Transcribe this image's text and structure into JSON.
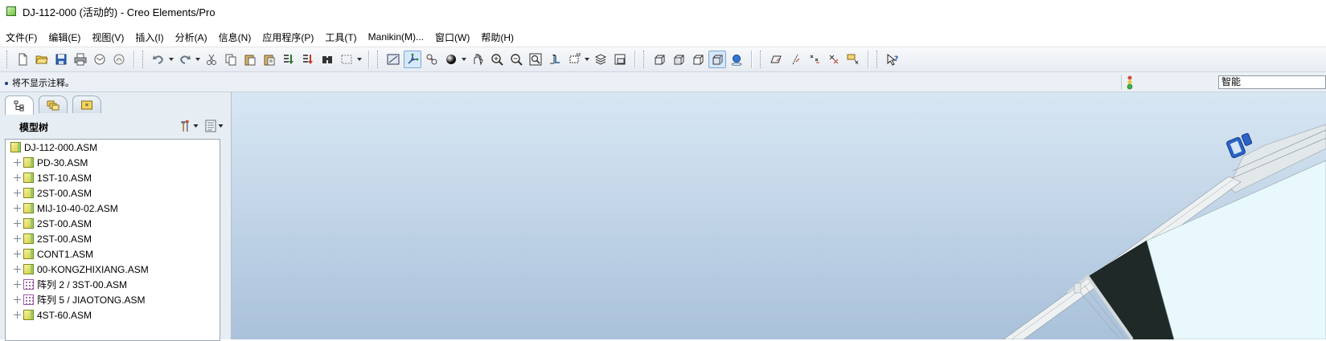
{
  "window": {
    "title": "DJ-112-000 (活动的) - Creo Elements/Pro"
  },
  "menu": [
    "文件(F)",
    "编辑(E)",
    "视图(V)",
    "插入(I)",
    "分析(A)",
    "信息(N)",
    "应用程序(P)",
    "工具(T)",
    "Manikin(M)...",
    "窗口(W)",
    "帮助(H)"
  ],
  "toolbar": {
    "groups": [
      [
        "new-file-icon",
        "open-file-icon",
        "save-icon",
        "print-icon",
        "email-icon",
        "email-link-icon"
      ],
      [
        "undo-icon",
        "redo-icon",
        "cut-icon",
        "copy-icon",
        "paste-icon",
        "paste-special-icon",
        "regenerate-icon",
        "regen-manager-icon",
        "find-icon",
        "select-box-icon"
      ],
      [
        "redraw-icon",
        "spin-center-icon",
        "orient-icon",
        "appearance-icon",
        "pan-zoom-icon",
        "zoom-in-icon",
        "zoom-out-icon",
        "refit-icon",
        "reorient-icon",
        "saved-views-icon",
        "layers-icon",
        "view-manager-icon"
      ],
      [
        "wireframe-icon",
        "hidden-line-icon",
        "no-hidden-icon",
        "shading-icon",
        "enhanced-realism-icon"
      ],
      [
        "datum-planes-icon",
        "datum-axes-icon",
        "datum-points-icon",
        "coordinate-systems-icon",
        "annotations-icon"
      ],
      [
        "whats-this-icon"
      ]
    ]
  },
  "message_bar": {
    "message": "将不显示注释。",
    "filter_value": "智能"
  },
  "left_panel": {
    "title": "模型树",
    "tabs": [
      "model-tree-tab",
      "folder-browser-tab",
      "favorites-tab"
    ],
    "tree": [
      {
        "label": "DJ-112-000.ASM",
        "type": "asm",
        "root": true
      },
      {
        "label": "PD-30.ASM",
        "type": "asm"
      },
      {
        "label": "1ST-10.ASM",
        "type": "asm"
      },
      {
        "label": "2ST-00.ASM",
        "type": "asm"
      },
      {
        "label": "MIJ-10-40-02.ASM",
        "type": "asm"
      },
      {
        "label": "2ST-00.ASM",
        "type": "asm"
      },
      {
        "label": "2ST-00.ASM",
        "type": "asm"
      },
      {
        "label": "CONT1.ASM",
        "type": "asm"
      },
      {
        "label": "00-KONGZHIXIANG.ASM",
        "type": "asm"
      },
      {
        "label": "阵列 2 / 3ST-00.ASM",
        "type": "pattern"
      },
      {
        "label": "阵列 5 / JIAOTONG.ASM",
        "type": "pattern"
      },
      {
        "label": "4ST-60.ASM",
        "type": "asm"
      }
    ]
  },
  "colors": {
    "viewport_top": "#d7e6f3",
    "viewport_bottom": "#a9c1da",
    "panel_bg": "#e6edf3",
    "model_dark": "#1f2a28",
    "model_face": "#e9f8fc",
    "model_blue": "#2a62c9"
  }
}
